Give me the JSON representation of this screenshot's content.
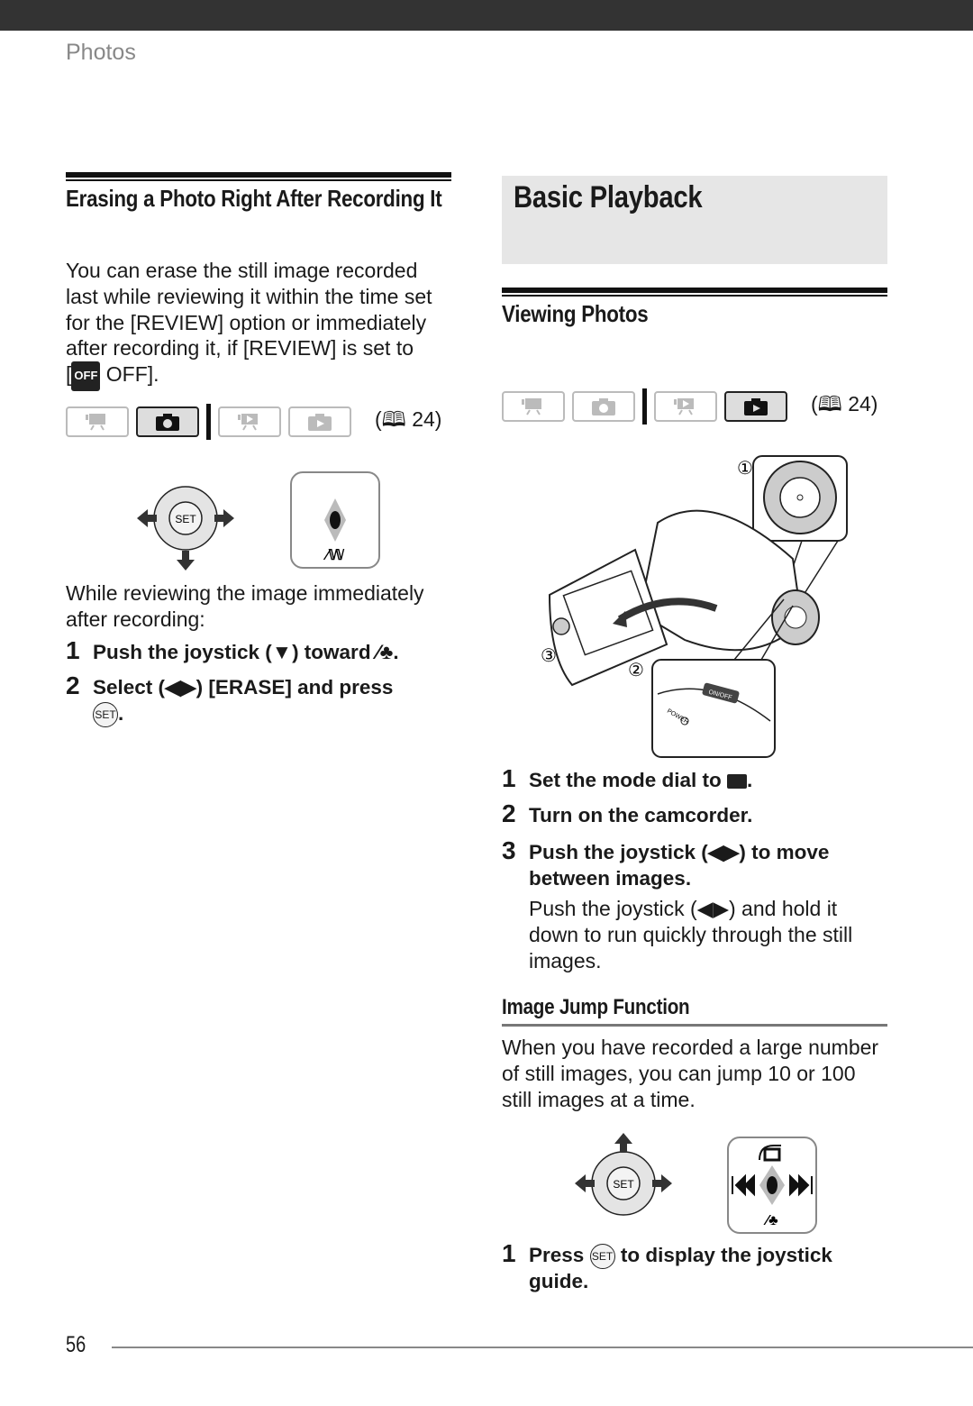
{
  "header": {
    "section": "Photos"
  },
  "left": {
    "heading": "Erasing a Photo Right After Recording It",
    "intro": [
      "You can erase the still image recorded",
      "last while reviewing it within the time set",
      "for the [REVIEW] option or immediately",
      "after recording it, if [REVIEW] is set to"
    ],
    "intro_last_pre": "[",
    "off_badge": "OFF",
    "intro_last_post": " OFF].",
    "mode_ref": "24",
    "mode_buttons": [
      {
        "name": "movie-record-mode",
        "active": false
      },
      {
        "name": "photo-record-mode",
        "active": true
      },
      {
        "name": "movie-playback-mode",
        "active": false
      },
      {
        "name": "photo-playback-mode",
        "active": false
      }
    ],
    "while_text": [
      "While reviewing the image immediately",
      "after recording:"
    ],
    "steps": [
      {
        "num": "1",
        "text": "Push the joystick (▼) toward",
        "suffix": "."
      },
      {
        "num": "2",
        "text": "Select (◀▶) [ERASE] and press",
        "suffix": "."
      }
    ],
    "set_label": "SET"
  },
  "right": {
    "title": "Basic Playback",
    "subheading": "Viewing Photos",
    "mode_ref": "24",
    "callouts": [
      "①",
      "②",
      "③"
    ],
    "dial_labels": {
      "power": "POWER",
      "onoff": "ON/OFF"
    },
    "steps": [
      {
        "num": "1",
        "text": "Set the mode dial to",
        "suffix": "."
      },
      {
        "num": "2",
        "text": "Turn on the camcorder."
      },
      {
        "num": "3",
        "text": "Push the joystick (◀▶) to move between images."
      }
    ],
    "step3_note": "Push the joystick (◀▶) and hold it down to run quickly through the still images.",
    "jump_heading": "Image Jump Function",
    "jump_text": "When you have recorded a large number of still images, you can jump 10 or 100 still images at a time.",
    "final_step": {
      "num": "1",
      "pre": "Press",
      "post": "to display the joystick guide."
    },
    "set_label": "SET"
  },
  "footer": {
    "page_number": "56"
  }
}
